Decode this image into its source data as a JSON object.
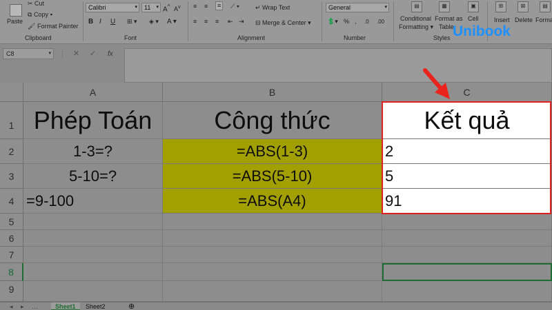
{
  "ribbon": {
    "clipboard": {
      "paste": "Paste",
      "cut": "Cut",
      "copy": "Copy",
      "format_painter": "Format Painter",
      "label": "Clipboard"
    },
    "font": {
      "name": "Calibri",
      "size": "11",
      "label": "Font"
    },
    "alignment": {
      "wrap_text": "Wrap Text",
      "merge_center": "Merge & Center",
      "label": "Alignment"
    },
    "number": {
      "format": "General",
      "label": "Number"
    },
    "styles": {
      "conditional": "Conditional",
      "formatting": "Formatting",
      "format_as": "Format as",
      "table": "Table",
      "cell": "Cell",
      "label": "Styles"
    },
    "cells": {
      "insert": "Insert",
      "delete": "Delete",
      "format": "Format"
    }
  },
  "watermark": {
    "text": "Unibook",
    "color": "#1e90ff"
  },
  "formula_bar": {
    "name_box": "C8",
    "fx": "fx",
    "cancel": "✕",
    "enter": "✓"
  },
  "columns": [
    "A",
    "B",
    "C"
  ],
  "rows": [
    "1",
    "2",
    "3",
    "4",
    "5",
    "6",
    "7",
    "8",
    "9"
  ],
  "cells": {
    "A1": "Phép Toán",
    "B1": "Công thức",
    "C1": "Kết quả",
    "A2": "1-3=?",
    "B2": "=ABS(1-3)",
    "C2": "2",
    "A3": "5-10=?",
    "B3": "=ABS(5-10)",
    "C3": "5",
    "A4": "=9-100",
    "B4": "=ABS(A4)",
    "C4": "91"
  },
  "colors": {
    "highlight_fill": "#a2a000",
    "result_border": "#e02020",
    "arrow": "#e8241c",
    "selected_cell_border": "#1e6b33"
  },
  "sheets": [
    "Sheet1",
    "Sheet2"
  ],
  "add_sheet": "⊕"
}
